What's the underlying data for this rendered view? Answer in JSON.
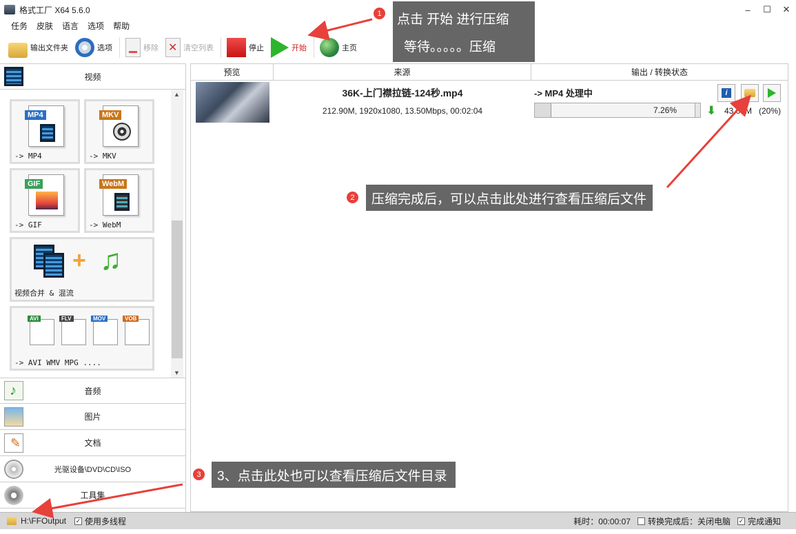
{
  "window": {
    "title": "格式工厂 X64 5.6.0",
    "minimize": "–",
    "maximize": "☐",
    "close": "✕"
  },
  "menu": [
    "任务",
    "皮肤",
    "语言",
    "选项",
    "帮助"
  ],
  "toolbar": {
    "output_folder": "输出文件夹",
    "options": "选项",
    "remove": "移除",
    "clear_list": "清空列表",
    "stop": "停止",
    "start": "开始",
    "home": "主页"
  },
  "categories": {
    "video": "视频",
    "audio": "音频",
    "image": "图片",
    "document": "文档",
    "disc": "光驱设备\\DVD\\CD\\ISO",
    "tools": "工具集"
  },
  "formats": {
    "mp4": {
      "tag": "MP4",
      "label": "-> MP4"
    },
    "mkv": {
      "tag": "MKV",
      "label": "-> MKV"
    },
    "gif": {
      "tag": "GIF",
      "label": "-> GIF"
    },
    "webm": {
      "tag": "WebM",
      "label": "-> WebM"
    },
    "merge": {
      "label": "视频合并 & 混流"
    },
    "multi": {
      "tags": [
        "AVI",
        "FLV",
        "MOV",
        "VOB"
      ],
      "label": "-> AVI WMV MPG ...."
    }
  },
  "list": {
    "headers": {
      "preview": "预览",
      "source": "来源",
      "output": "输出 / 转换状态"
    },
    "row": {
      "filename": "36K-上门襟拉链-124秒.mp4",
      "info": "212.90M, 1920x1080, 13.50Mbps, 00:02:04",
      "status": "-> MP4 处理中",
      "progress_text": "7.26%",
      "progress": 7.26,
      "size": "43.05M",
      "ratio": "(20%)"
    }
  },
  "statusbar": {
    "output_path": "H:\\FFOutput",
    "multithread": "使用多线程",
    "elapsed": "耗时：00:00:07",
    "after_done": "转换完成后：关闭电脑",
    "notify": "完成通知",
    "check": "✓"
  },
  "annotations": {
    "a1_num": "1",
    "a1_line1": "点击 开始  进行压缩",
    "a1_line2": "等待。。。。。压缩",
    "a2_num": "2",
    "a2_text": "压缩完成后，可以点击此处进行查看压缩后文件",
    "a3_num": "3",
    "a3_text": "3、点击此处也可以查看压缩后文件目录",
    "color": "#e8403a"
  }
}
